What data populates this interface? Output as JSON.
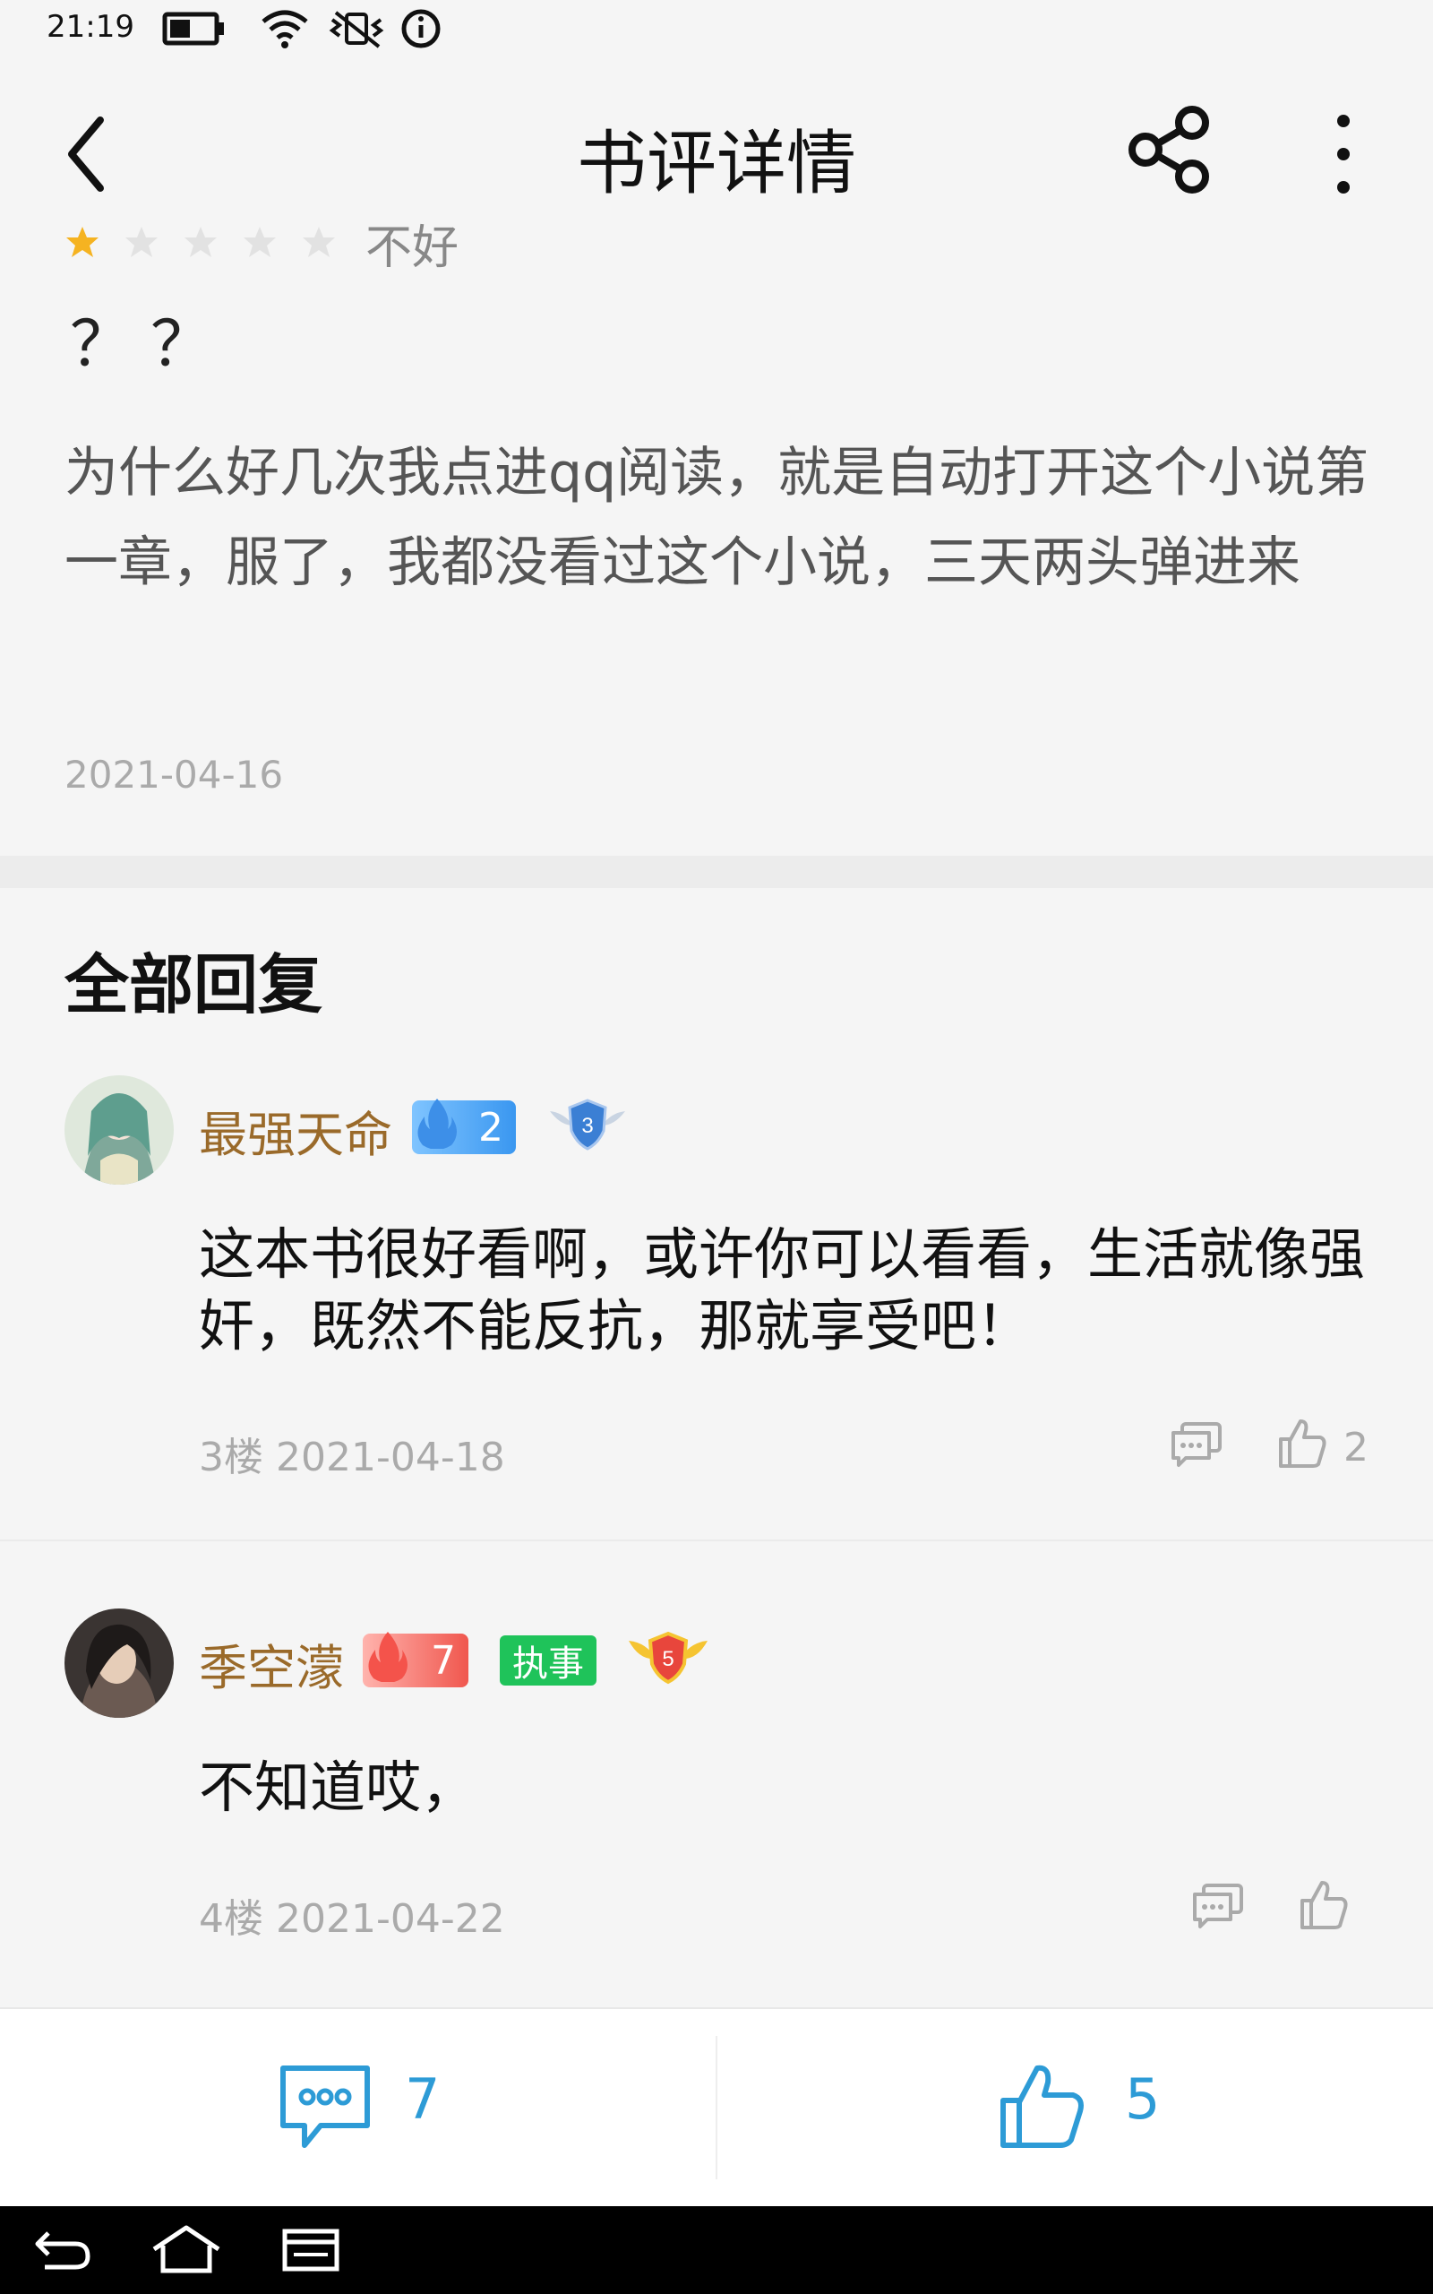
{
  "status_bar": {
    "time": "21:19"
  },
  "header": {
    "title": "书评详情"
  },
  "review": {
    "rating": {
      "score": 1,
      "max": 5,
      "label": "不好"
    },
    "title": "？？",
    "body": "为什么好几次我点进qq阅读，就是自动打开这个小说第一章，服了，我都没看过这个小说，三天两头弹进来",
    "date": "2021-04-16"
  },
  "replies": {
    "section_title": "全部回复",
    "items": [
      {
        "username": "最强天命",
        "level": "2",
        "medal_level": "3",
        "text": "这本书很好看啊，或许你可以看看，生活就像强奸，既然不能反抗，那就享受吧！",
        "meta": "3楼 2021-04-18",
        "likes": "2"
      },
      {
        "username": "季空濛",
        "level": "7",
        "role_tag": "执事",
        "medal_level": "5",
        "text": "不知道哎，",
        "meta": "4楼 2021-04-22",
        "likes": ""
      }
    ]
  },
  "bottom_bar": {
    "comment_count": "7",
    "like_count": "5"
  },
  "colors": {
    "accent": "#2d9bd6",
    "username": "#9a6a2a",
    "star": "#f5b321",
    "tag_green": "#1fc35a"
  }
}
